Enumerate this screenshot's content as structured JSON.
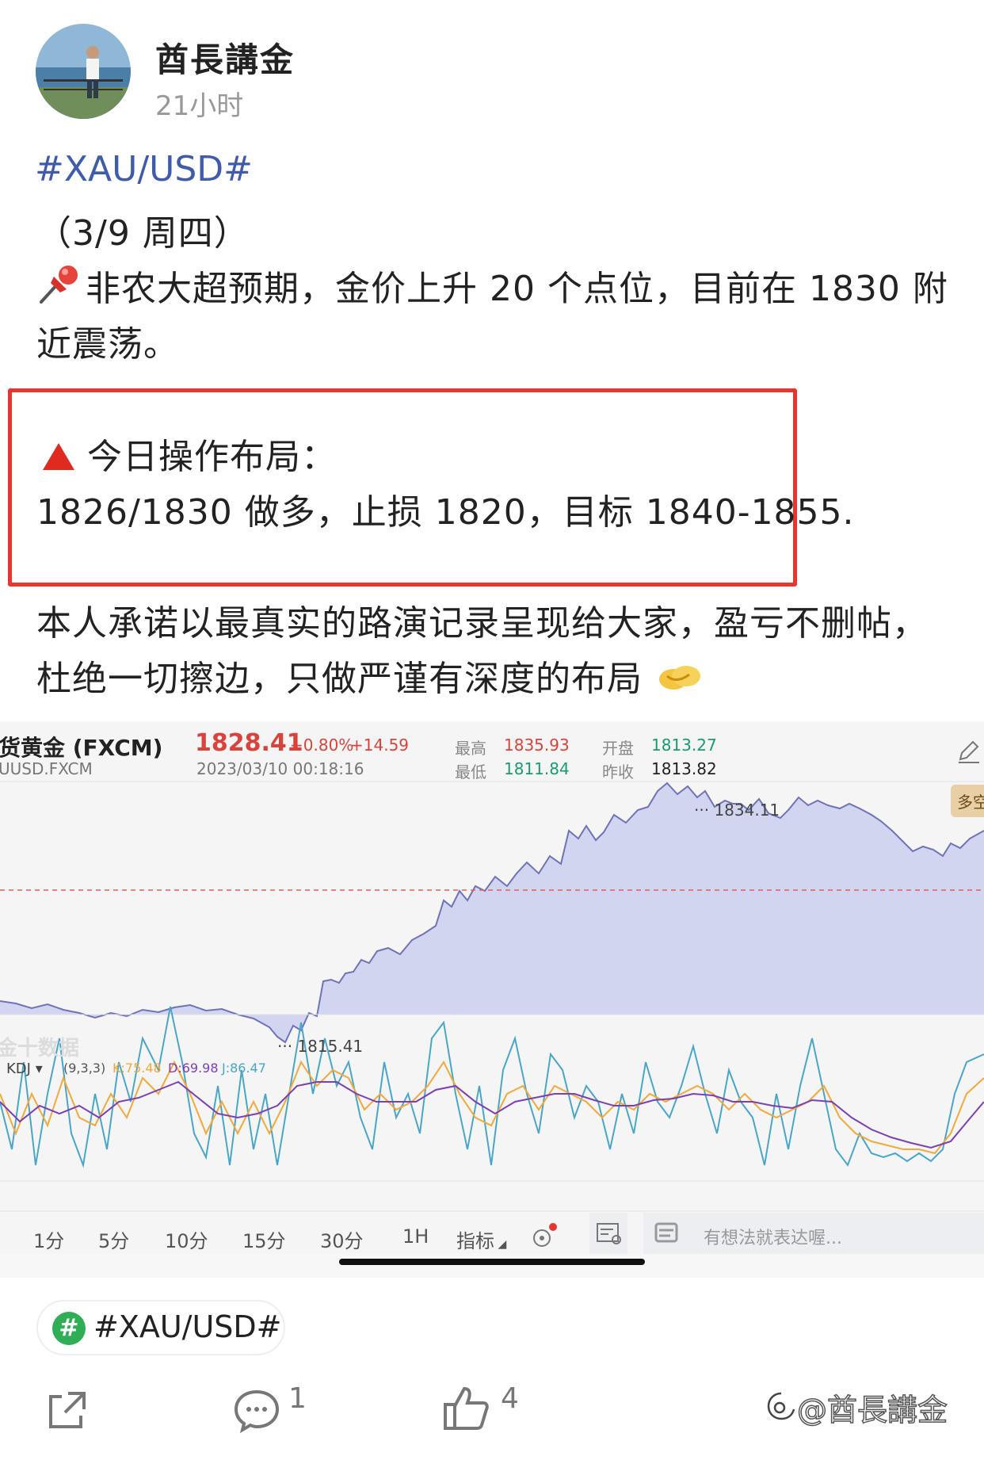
{
  "post": {
    "author": "酋長講金",
    "time": "21小时",
    "topic": "#XAU/USD#",
    "date_line": "（3/9 周四）",
    "para1_line1": "非农大超预期，金价上升 20 个点位，目前在 1830 附",
    "para1_line2": "近震荡。",
    "plan_title": "今日操作布局：",
    "plan_text": "1826/1830 做多，止损 1820，目标 1840-1855.",
    "para2_line1": "本人承诺以最真实的路演记录呈现给大家，盈亏不删帖，",
    "para2_line2": "杜绝一切擦边，只做严谨有深度的布局"
  },
  "ticker": {
    "name": "货黄金 (FXCM)",
    "code": "UUSD.FXCM",
    "price": "1828.41",
    "change_pct": "+0.80%",
    "change_abs": "+14.59",
    "datetime": "2023/03/10 00:18:16",
    "high_label": "最高",
    "high": "1835.93",
    "low_label": "最低",
    "low": "1811.84",
    "open_label": "开盘",
    "open": "1813.27",
    "prev_label": "昨收",
    "prev": "1813.82",
    "badge": "多空",
    "peak_label": "1834.11",
    "trough_label": "1815.41",
    "watermark": "金十数据"
  },
  "kdj": {
    "name": "KDJ",
    "params": "(9,3,3)",
    "k": "K:75.48",
    "d": "D:69.98",
    "j": "J:86.47"
  },
  "timeframes": [
    "1分",
    "5分",
    "10分",
    "15分",
    "30分",
    "1H"
  ],
  "toolbar": {
    "indicator": "指标",
    "comment_placeholder": "有想法就表达喔..."
  },
  "footer": {
    "tag": "#XAU/USD#",
    "comments": "1",
    "likes": "4",
    "watermark": "@酋長講金"
  },
  "colors": {
    "topic_blue": "#3f5ba9",
    "red_box": "#e8362f",
    "price_red": "#d9433b",
    "low_green": "#1a9b6b",
    "area_fill": "#c9cdef",
    "area_line": "#6e73b8",
    "k_line": "#f2a93b",
    "d_line": "#7b3fb5",
    "j_line": "#4aa6c8"
  }
}
